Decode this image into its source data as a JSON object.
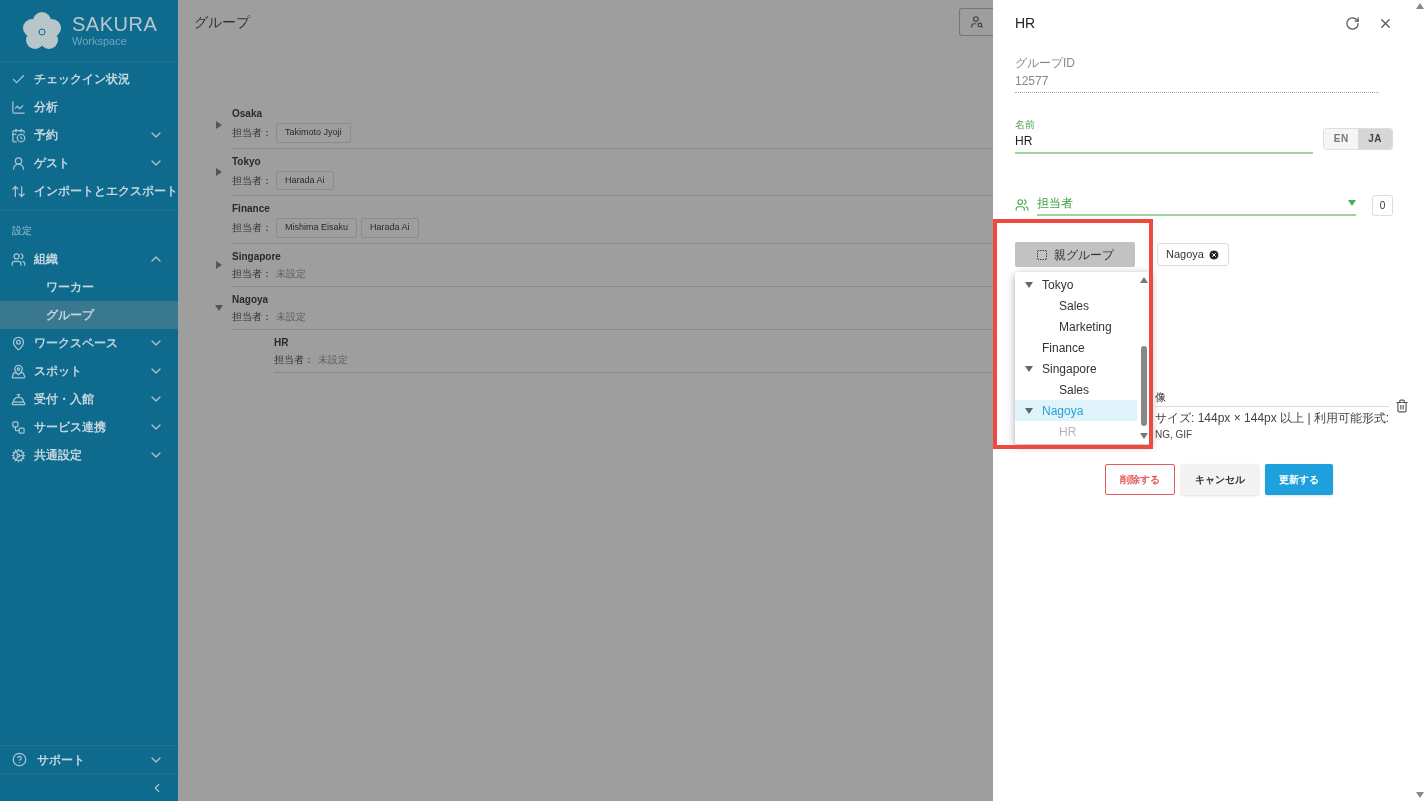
{
  "sidebar": {
    "logo": {
      "title": "SAKURA",
      "subtitle": "Workspace"
    },
    "items": [
      {
        "label": "チェックイン状況",
        "kind": "link",
        "selected": false
      },
      {
        "label": "分析",
        "kind": "link",
        "selected": false
      },
      {
        "label": "予約",
        "kind": "menu",
        "expanded": false,
        "selected": false
      },
      {
        "label": "ゲスト",
        "kind": "menu",
        "expanded": false,
        "selected": false
      },
      {
        "label": "インポートとエクスポート",
        "kind": "link",
        "selected": false
      }
    ],
    "section_label": "設定",
    "settings_items": [
      {
        "label": "組織",
        "kind": "menu",
        "expanded": true,
        "selected": false,
        "children": [
          {
            "label": "ワーカー",
            "selected": false
          },
          {
            "label": "グループ",
            "selected": true
          }
        ]
      },
      {
        "label": "ワークスペース",
        "kind": "menu",
        "expanded": false,
        "selected": false
      },
      {
        "label": "スポット",
        "kind": "menu",
        "expanded": false,
        "selected": false
      },
      {
        "label": "受付・入館",
        "kind": "menu",
        "expanded": false,
        "selected": false
      },
      {
        "label": "サービス連携",
        "kind": "menu",
        "expanded": false,
        "selected": false
      },
      {
        "label": "共通設定",
        "kind": "menu",
        "expanded": false,
        "selected": false
      }
    ],
    "footer_item": {
      "label": "サポート",
      "kind": "menu",
      "expanded": false
    }
  },
  "main": {
    "title": "グループ",
    "groups": [
      {
        "name": "Osaka",
        "owner_label": "担当者：",
        "owners": [
          "Takimoto Jyoji"
        ],
        "expanded": false
      },
      {
        "name": "Tokyo",
        "owner_label": "担当者：",
        "owners": [
          "Harada Ai"
        ],
        "expanded": false
      },
      {
        "name": "Finance",
        "owner_label": "担当者：",
        "owners": [
          "Mishima Eisaku",
          "Harada Ai"
        ]
      },
      {
        "name": "Singapore",
        "owner_label": "担当者：",
        "unset": "未設定",
        "expanded": false
      },
      {
        "name": "Nagoya",
        "owner_label": "担当者：",
        "unset": "未設定",
        "expanded": true,
        "children": [
          {
            "name": "HR",
            "owner_label": "担当者：",
            "unset": "未設定"
          }
        ]
      }
    ]
  },
  "panel": {
    "title": "HR",
    "group_id": {
      "label": "グループID",
      "value": "12577"
    },
    "name": {
      "label": "名前",
      "value": "HR"
    },
    "languages": [
      {
        "label": "EN",
        "selected": false
      },
      {
        "label": "JA",
        "selected": true
      }
    ],
    "owners": {
      "label": "担当者",
      "count": "0"
    },
    "parent_button": "親グループ",
    "parent_chip": "Nagoya",
    "dropdown": {
      "items": [
        {
          "label": "Tokyo",
          "expanded": true,
          "selected": false,
          "disabled": false,
          "children": [
            {
              "label": "Sales",
              "selected": false,
              "disabled": false
            },
            {
              "label": "Marketing",
              "selected": false,
              "disabled": false
            }
          ]
        },
        {
          "label": "Finance",
          "selected": false,
          "disabled": false
        },
        {
          "label": "Singapore",
          "expanded": true,
          "selected": false,
          "disabled": false,
          "children": [
            {
              "label": "Sales",
              "selected": false,
              "disabled": false
            }
          ]
        },
        {
          "label": "Nagoya",
          "expanded": true,
          "selected": true,
          "disabled": false,
          "children": [
            {
              "label": "HR",
              "selected": false,
              "disabled": true
            }
          ]
        }
      ]
    },
    "image": {
      "title_part": "像",
      "hint_part": "サイズ: 144px × 144px 以上 | 利用可能形式:",
      "formats_part": "NG, GIF"
    },
    "buttons": [
      {
        "label": "削除する",
        "kind": "danger"
      },
      {
        "label": "キャンセル",
        "kind": "default"
      },
      {
        "label": "更新する",
        "kind": "primary"
      }
    ]
  }
}
